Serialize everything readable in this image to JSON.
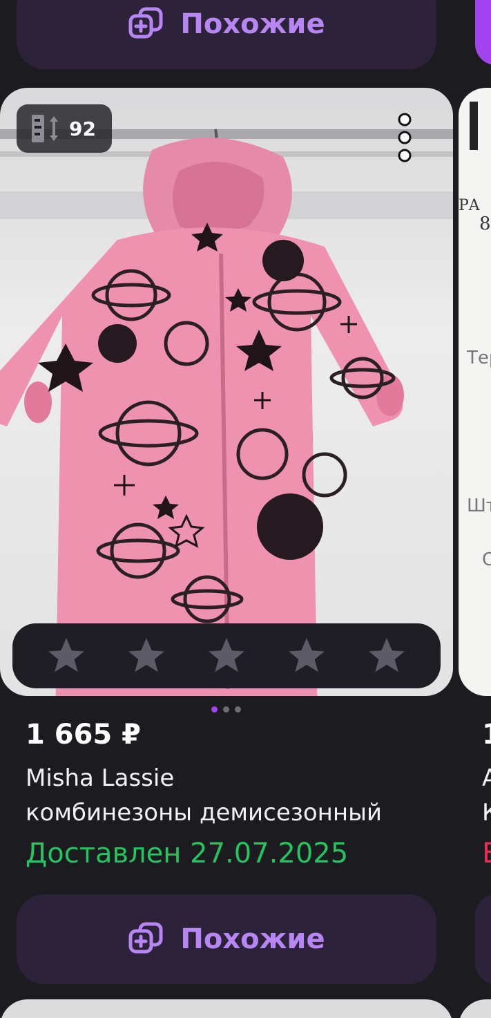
{
  "similar_button": {
    "label": "Похожие",
    "icon": "add-similar-icon",
    "color": "#b886f2"
  },
  "product": {
    "size_badge": {
      "icon": "size-height-icon",
      "value": "92"
    },
    "more_icon": "more-vertical-icon",
    "rating": {
      "stars_total": 5,
      "stars_filled": 0
    },
    "pager": {
      "total": 3,
      "active": 0
    },
    "price": "1 665 ₽",
    "brand": "Misha Lassie",
    "title": "комбинезоны демисезонный",
    "delivery": "Доставлен 27.07.2025",
    "delivery_color": "#22c55e"
  },
  "right_card": {
    "price": "1",
    "line1": "A",
    "line2": "К",
    "line3": "E",
    "image_text": {
      "t1": "PA",
      "t2": "8",
      "t3": "Тер",
      "t4": "Штр",
      "t5": "С"
    }
  }
}
